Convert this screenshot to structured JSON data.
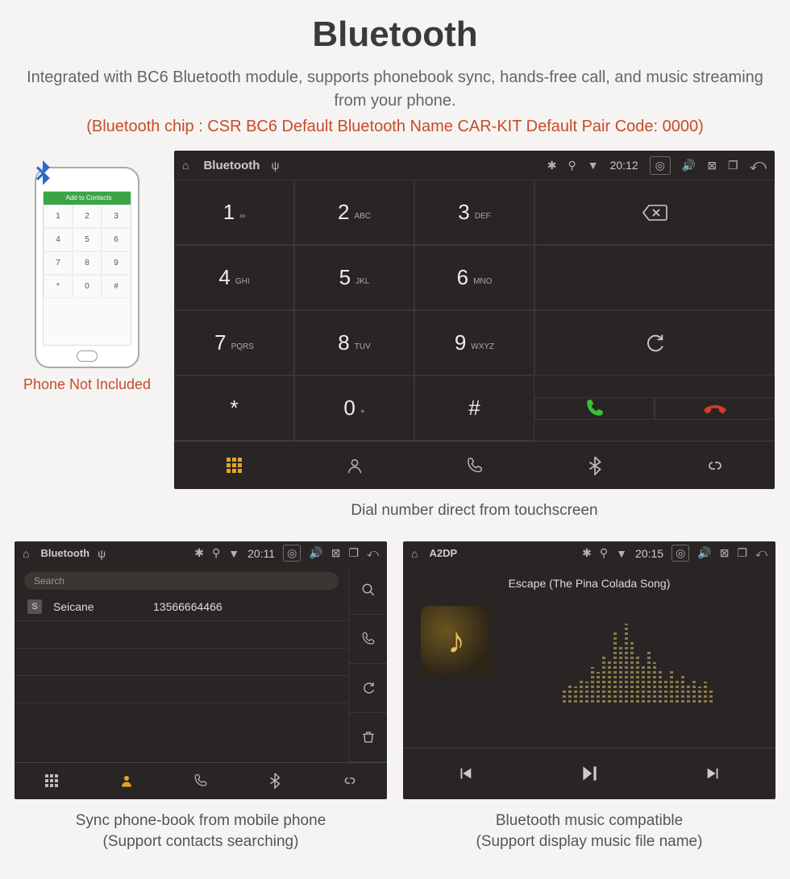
{
  "heading": "Bluetooth",
  "description": "Integrated with BC6 Bluetooth module, supports phonebook sync, hands-free call, and music streaming from your phone.",
  "specs": "(Bluetooth chip : CSR BC6    Default Bluetooth Name CAR-KIT    Default Pair Code: 0000)",
  "phone": {
    "barText": "Add to Contacts",
    "notIncluded": "Phone Not Included",
    "keys": [
      "1",
      "2",
      "3",
      "4",
      "5",
      "6",
      "7",
      "8",
      "9",
      "*",
      "0",
      "#"
    ]
  },
  "dialer": {
    "status": {
      "title": "Bluetooth",
      "time": "20:12"
    },
    "keys": [
      {
        "num": "1",
        "sub": "∞"
      },
      {
        "num": "2",
        "sub": "ABC"
      },
      {
        "num": "3",
        "sub": "DEF"
      },
      {
        "num": "4",
        "sub": "GHI"
      },
      {
        "num": "5",
        "sub": "JKL"
      },
      {
        "num": "6",
        "sub": "MNO"
      },
      {
        "num": "7",
        "sub": "PQRS"
      },
      {
        "num": "8",
        "sub": "TUV"
      },
      {
        "num": "9",
        "sub": "WXYZ"
      },
      {
        "num": "*",
        "sub": ""
      },
      {
        "num": "0",
        "sub": "+"
      },
      {
        "num": "#",
        "sub": ""
      }
    ],
    "caption": "Dial number direct from touchscreen"
  },
  "contacts": {
    "status": {
      "title": "Bluetooth",
      "time": "20:11"
    },
    "searchPlaceholder": "Search",
    "row": {
      "badge": "S",
      "name": "Seicane",
      "number": "13566664466"
    },
    "caption1": "Sync phone-book from mobile phone",
    "caption2": "(Support contacts searching)"
  },
  "music": {
    "status": {
      "title": "A2DP",
      "time": "20:15"
    },
    "track": "Escape (The Pina Colada Song)",
    "caption1": "Bluetooth music compatible",
    "caption2": "(Support display music file name)"
  }
}
